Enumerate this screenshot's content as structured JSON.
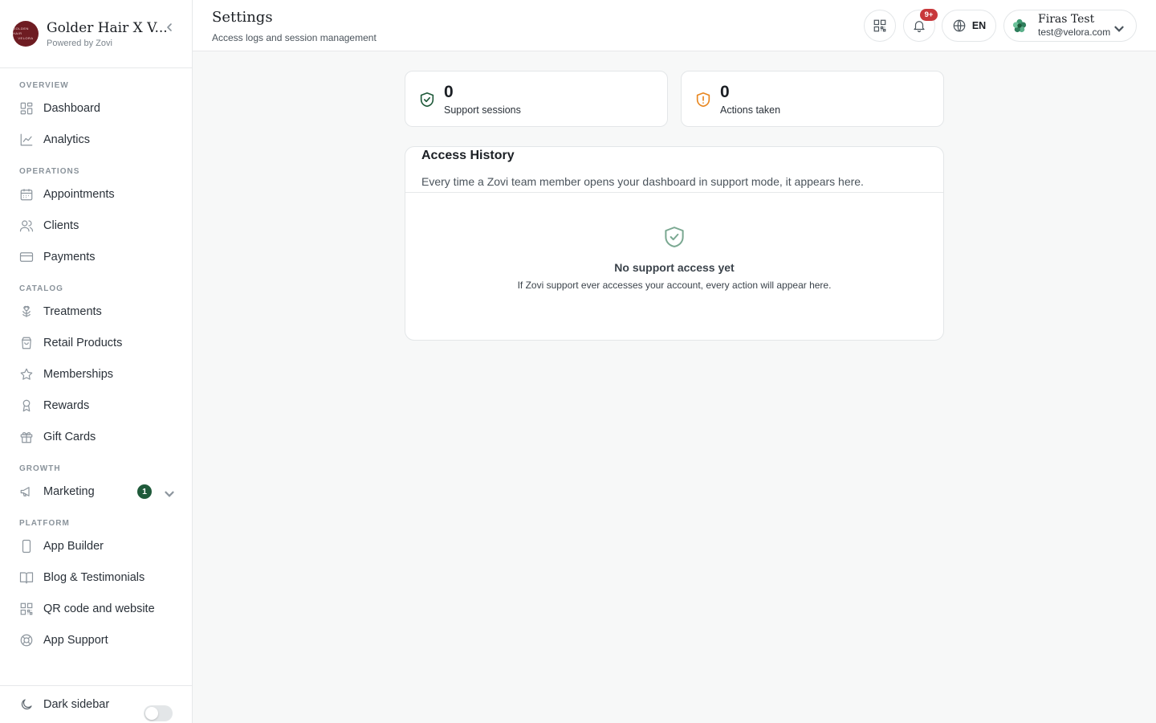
{
  "brand": {
    "name": "Golder Hair X V...",
    "powered_by": "Powered by Zovi",
    "logo_top": "GOLDEN HAIR",
    "logo_bottom": "VELORA"
  },
  "sidebar": {
    "sections": [
      {
        "title": "OVERVIEW",
        "items": [
          {
            "label": "Dashboard",
            "icon": "dashboard-icon"
          },
          {
            "label": "Analytics",
            "icon": "analytics-icon"
          }
        ]
      },
      {
        "title": "OPERATIONS",
        "items": [
          {
            "label": "Appointments",
            "icon": "calendar-icon"
          },
          {
            "label": "Clients",
            "icon": "users-icon"
          },
          {
            "label": "Payments",
            "icon": "credit-card-icon"
          }
        ]
      },
      {
        "title": "CATALOG",
        "items": [
          {
            "label": "Treatments",
            "icon": "flower-icon"
          },
          {
            "label": "Retail Products",
            "icon": "shopping-bag-icon"
          },
          {
            "label": "Memberships",
            "icon": "star-icon"
          },
          {
            "label": "Rewards",
            "icon": "award-icon"
          },
          {
            "label": "Gift Cards",
            "icon": "gift-icon"
          }
        ]
      },
      {
        "title": "GROWTH",
        "items": [
          {
            "label": "Marketing",
            "icon": "megaphone-icon",
            "badge": "1"
          }
        ]
      },
      {
        "title": "PLATFORM",
        "items": [
          {
            "label": "App Builder",
            "icon": "smartphone-icon"
          },
          {
            "label": "Blog & Testimonials",
            "icon": "book-open-icon"
          },
          {
            "label": "QR code and website",
            "icon": "qr-code-icon"
          },
          {
            "label": "App Support",
            "icon": "life-buoy-icon"
          }
        ]
      }
    ],
    "footer": {
      "label": "Dark sidebar",
      "icon": "moon-icon",
      "toggle_on": false
    }
  },
  "header": {
    "title": "Settings",
    "subtitle": "Access logs and session management",
    "notification_badge": "9+",
    "language": "EN",
    "user": {
      "name": "Firas Test",
      "email": "test@velora.com"
    }
  },
  "stats": [
    {
      "value": "0",
      "label": "Support sessions",
      "icon": "shield-check-icon",
      "color": "#1f5a3a"
    },
    {
      "value": "0",
      "label": "Actions taken",
      "icon": "shield-alert-icon",
      "color": "#e8861f"
    }
  ],
  "access_history": {
    "title": "Access History",
    "description": "Every time a Zovi team member opens your dashboard in support mode, it appears here.",
    "empty_title": "No support access yet",
    "empty_description": "If Zovi support ever accesses your account, every action will appear here."
  },
  "colors": {
    "accent": "#1f5a3a",
    "brand": "#6e1c22",
    "notification": "#c8383b",
    "warning": "#e8861f"
  }
}
